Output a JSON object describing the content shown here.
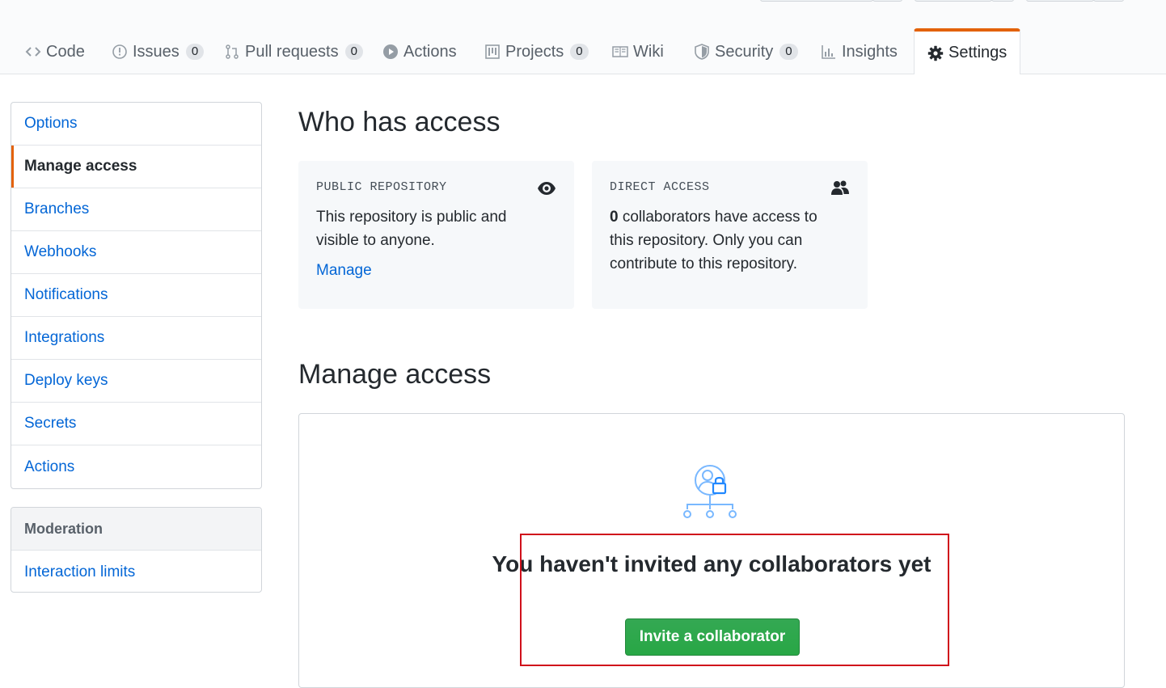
{
  "tabs": [
    {
      "label": "Code",
      "icon": "code-icon"
    },
    {
      "label": "Issues",
      "count": "0",
      "icon": "issue-icon"
    },
    {
      "label": "Pull requests",
      "count": "0",
      "icon": "pull-request-icon"
    },
    {
      "label": "Actions",
      "icon": "play-icon"
    },
    {
      "label": "Projects",
      "count": "0",
      "icon": "project-icon"
    },
    {
      "label": "Wiki",
      "icon": "book-icon"
    },
    {
      "label": "Security",
      "count": "0",
      "icon": "shield-icon"
    },
    {
      "label": "Insights",
      "icon": "graph-icon"
    },
    {
      "label": "Settings",
      "icon": "gear-icon",
      "selected": true
    }
  ],
  "sidebar": {
    "items": [
      "Options",
      "Manage access",
      "Branches",
      "Webhooks",
      "Notifications",
      "Integrations",
      "Deploy keys",
      "Secrets",
      "Actions"
    ],
    "selected": "Manage access",
    "moderation_heading": "Moderation",
    "moderation_items": [
      "Interaction limits"
    ]
  },
  "who_has_access": {
    "title": "Who has access",
    "public_card": {
      "label": "PUBLIC REPOSITORY",
      "text": "This repository is public and visible to anyone.",
      "link": "Manage",
      "icon": "eye-icon"
    },
    "direct_card": {
      "label": "DIRECT ACCESS",
      "count": "0",
      "text": " collaborators have access to this repository. Only you can contribute to this repository.",
      "icon": "people-icon"
    }
  },
  "manage_access": {
    "title": "Manage access",
    "blank_title": "You haven't invited any collaborators yet",
    "invite_button": "Invite a collaborator",
    "icon": "person-lock-network-icon"
  },
  "colors": {
    "link": "#0366d6",
    "accent": "#e36209",
    "primary_button": "#28a745",
    "highlight": "#d0101b"
  }
}
